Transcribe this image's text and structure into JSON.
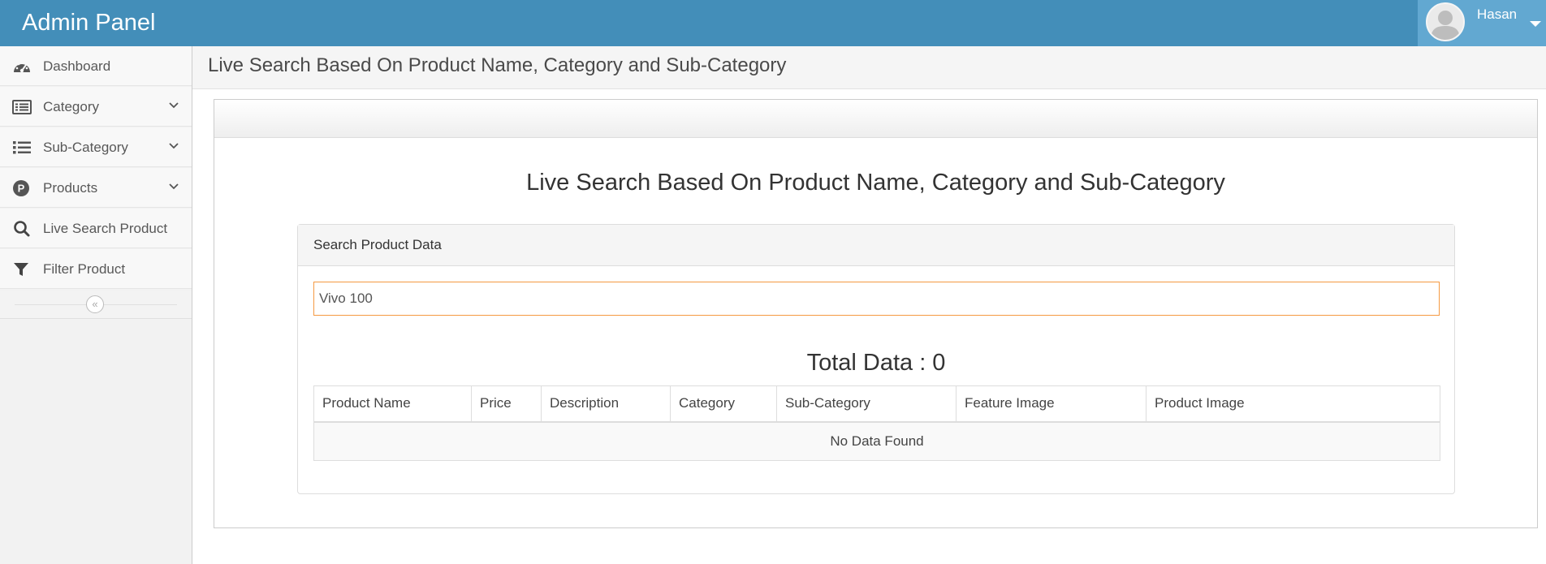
{
  "app": {
    "title": "Admin Panel"
  },
  "user": {
    "name": "Hasan",
    "avatar_icon": "user-avatar-icon"
  },
  "sidebar": {
    "items": [
      {
        "label": "Dashboard",
        "icon": "dashboard-icon",
        "has_submenu": false
      },
      {
        "label": "Category",
        "icon": "list-alt-icon",
        "has_submenu": true
      },
      {
        "label": "Sub-Category",
        "icon": "list-icon",
        "has_submenu": true
      },
      {
        "label": "Products",
        "icon": "product-p-icon",
        "has_submenu": true
      },
      {
        "label": "Live Search Product",
        "icon": "search-icon",
        "has_submenu": false
      },
      {
        "label": "Filter Product",
        "icon": "filter-icon",
        "has_submenu": false
      }
    ],
    "collapse_icon": "double-chevron-left-icon"
  },
  "page": {
    "header_title": "Live Search Based On Product Name, Category and Sub-Category",
    "main_title": "Live Search Based On Product Name, Category and Sub-Category"
  },
  "search_panel": {
    "heading": "Search Product Data",
    "input_value": "Vivo 100"
  },
  "results": {
    "total_label": "Total Data : 0",
    "columns": [
      "Product Name",
      "Price",
      "Description",
      "Category",
      "Sub-Category",
      "Feature Image",
      "Product Image"
    ],
    "empty_message": "No Data Found"
  },
  "colors": {
    "navbar": "#438eb9",
    "user_area": "#62a8d1",
    "input_focus_border": "#f59942"
  }
}
